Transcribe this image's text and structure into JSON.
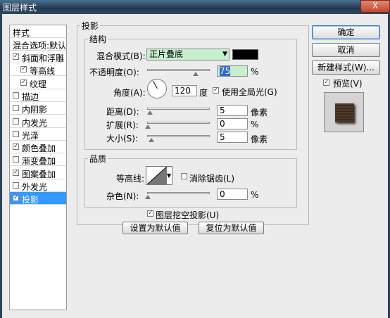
{
  "window": {
    "title": "图层样式",
    "close_label": "X"
  },
  "left_list": {
    "header": "样式",
    "blend_options": "混合选项:默认",
    "items": [
      {
        "label": "斜面和浮雕",
        "checked": true
      },
      {
        "label": "等高线",
        "checked": true
      },
      {
        "label": "纹理",
        "checked": true
      },
      {
        "label": "描边",
        "checked": false
      },
      {
        "label": "内阴影",
        "checked": false
      },
      {
        "label": "内发光",
        "checked": false
      },
      {
        "label": "光泽",
        "checked": false
      },
      {
        "label": "颜色叠加",
        "checked": true
      },
      {
        "label": "渐变叠加",
        "checked": false
      },
      {
        "label": "图案叠加",
        "checked": true
      },
      {
        "label": "外发光",
        "checked": false
      },
      {
        "label": "投影",
        "checked": true
      }
    ]
  },
  "panel": {
    "group_title": "投影",
    "structure": {
      "title": "结构",
      "blend_mode_label": "混合模式(B):",
      "blend_mode_value": "正片叠底",
      "shadow_color": "#000000",
      "opacity_label": "不透明度(O):",
      "opacity_value": "75",
      "opacity_unit": "%",
      "opacity_level": 0.75,
      "angle_label": "角度(A):",
      "angle_value": "120",
      "angle_unit": "度",
      "global_light_label": "使用全局光(G)",
      "global_light_checked": true,
      "distance_label": "距离(D):",
      "distance_value": "5",
      "distance_unit": "像素",
      "spread_label": "扩展(R):",
      "spread_value": "0",
      "spread_unit": "%",
      "size_label": "大小(S):",
      "size_value": "5",
      "size_unit": "像素"
    },
    "quality": {
      "title": "品质",
      "contour_label": "等高线:",
      "antialias_label": "消除锯齿(L)",
      "antialias_checked": false,
      "noise_label": "杂色(N):",
      "noise_value": "0",
      "noise_unit": "%"
    },
    "knockout_label": "图层挖空投影(U)",
    "knockout_checked": true,
    "make_default_label": "设置为默认值",
    "reset_default_label": "复位为默认值"
  },
  "right": {
    "ok_label": "确定",
    "cancel_label": "取消",
    "new_style_label": "新建样式(W)...",
    "preview_label": "预览(V)",
    "preview_checked": true
  }
}
